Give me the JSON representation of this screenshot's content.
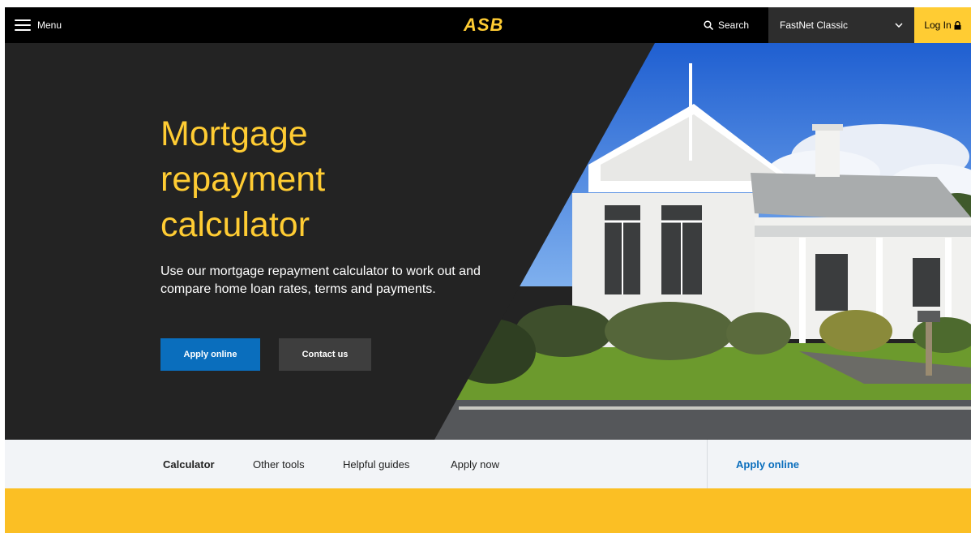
{
  "header": {
    "menu_label": "Menu",
    "logo_text": "ASB",
    "search_label": "Search",
    "product_selector": "FastNet Classic",
    "login_label": "Log In"
  },
  "hero": {
    "title_line1": "Mortgage",
    "title_line2": "repayment",
    "title_line3": "calculator",
    "description": "Use our mortgage repayment calculator to work out and compare home loan rates, terms and payments.",
    "apply_button": "Apply online",
    "contact_button": "Contact us"
  },
  "subnav": {
    "items": [
      {
        "label": "Calculator"
      },
      {
        "label": "Other tools"
      },
      {
        "label": "Helpful guides"
      },
      {
        "label": "Apply now"
      }
    ],
    "apply_link": "Apply online"
  },
  "colors": {
    "brand_yellow": "#ffcc33",
    "primary_blue": "#0a6ebd",
    "dark_bg": "#232323",
    "band_yellow": "#fbbf24"
  },
  "icons": {
    "menu": "hamburger-icon",
    "search": "search-icon",
    "dropdown": "chevron-down-icon",
    "login": "lock-icon"
  }
}
